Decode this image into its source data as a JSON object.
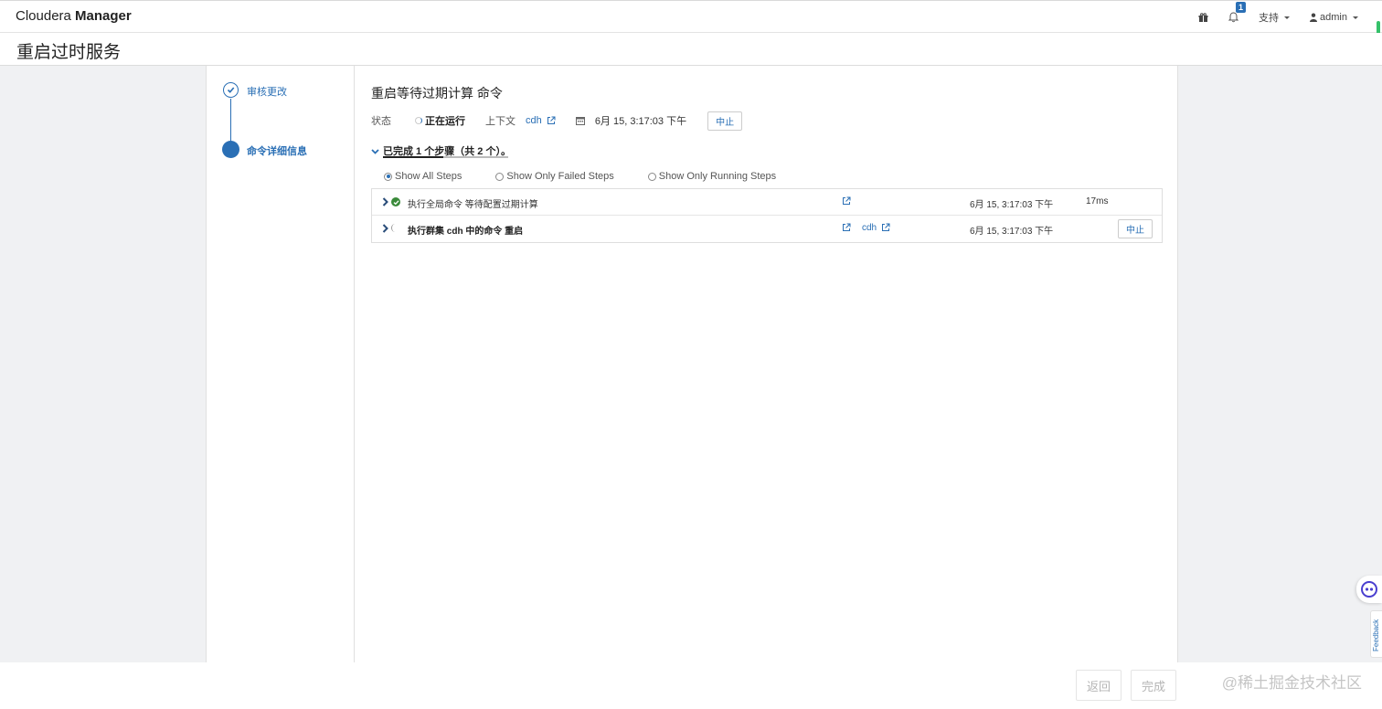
{
  "navbar": {
    "brand_light": "Cloudera",
    "brand_bold": "Manager",
    "icons": [
      "gift-icon",
      "bell-icon",
      "user-icon"
    ],
    "notification_count": "1",
    "support_label": "支持",
    "user_label": "admin"
  },
  "page": {
    "title": "重启过时服务"
  },
  "wizard": {
    "steps": [
      {
        "label": "审核更改",
        "state": "done"
      },
      {
        "label": "命令详细信息",
        "state": "active"
      }
    ]
  },
  "command": {
    "title": "重启等待过期计算 命令",
    "status_label": "状态",
    "status_value": "正在运行",
    "context_label": "上下文",
    "context_value": "cdh",
    "timestamp": "6月 15, 3:17:03 下午",
    "abort_label": "中止",
    "progress_text": "已完成 1 个步骤（共 2 个）。"
  },
  "filters": [
    {
      "label": "Show All Steps",
      "selected": true
    },
    {
      "label": "Show Only Failed Steps",
      "selected": false
    },
    {
      "label": "Show Only Running Steps",
      "selected": false
    }
  ],
  "steps": [
    {
      "name": "执行全局命令 等待配置过期计算",
      "status": "success",
      "context": "",
      "time": "6月 15, 3:17:03 下午",
      "duration": "17ms",
      "action": ""
    },
    {
      "name": "执行群集 cdh 中的命令 重启",
      "status": "running",
      "context": "cdh",
      "time": "6月 15, 3:17:03 下午",
      "duration": "",
      "action": "中止"
    }
  ],
  "footer": {
    "back_label": "返回",
    "finish_label": "完成",
    "watermark": "@稀土掘金技术社区"
  },
  "widgets": {
    "feedback_label": "Feedback"
  },
  "colors": {
    "accent": "#2a6fb5",
    "success": "#3a8a3a",
    "background": "#f0f1f3"
  }
}
